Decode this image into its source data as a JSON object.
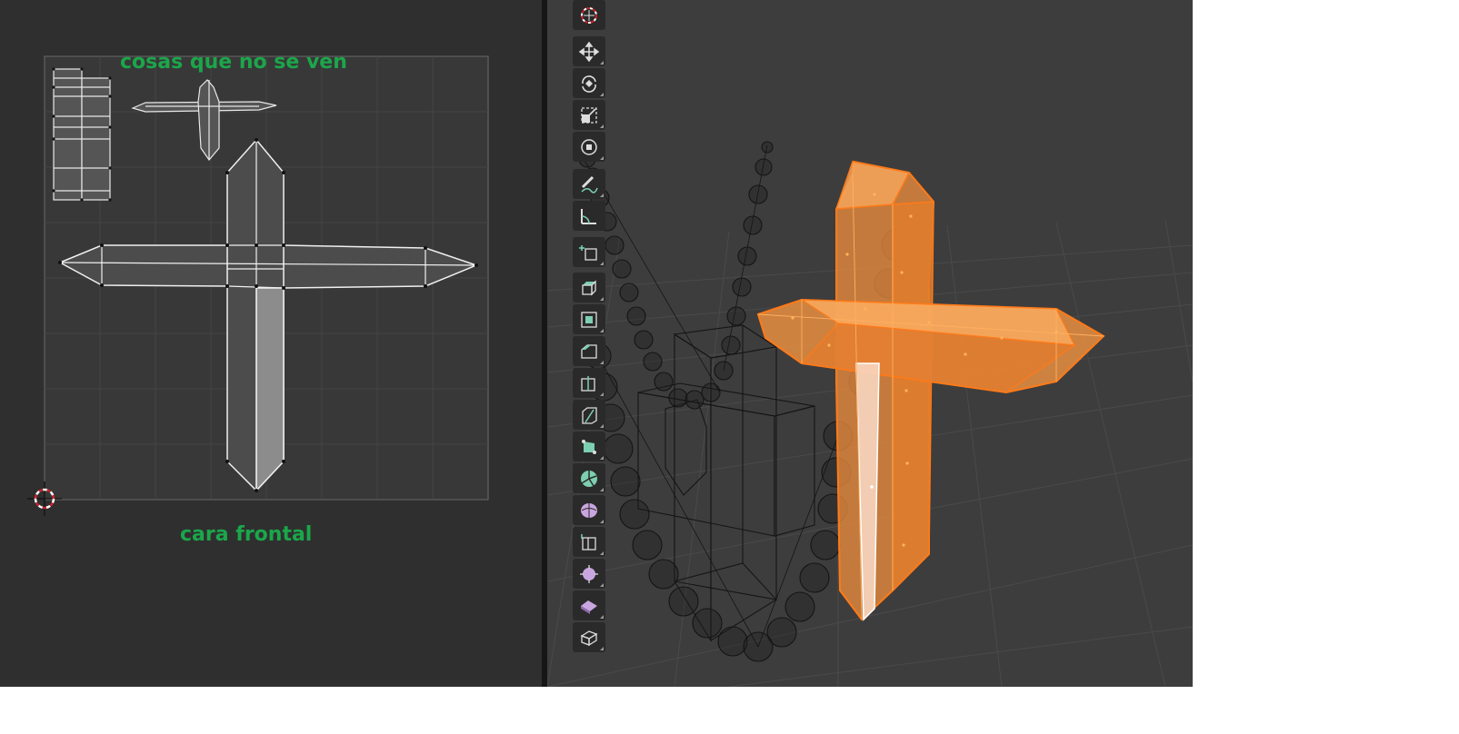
{
  "uv_editor": {
    "annotations": {
      "top_label": "cosas que no se ven",
      "bottom_label": "cara frontal"
    }
  },
  "viewport": {
    "selected_object_color": "#f08a24",
    "wire_color": "#151515"
  },
  "toolbar": {
    "tools": [
      {
        "name": "cursor-tool",
        "icon": "crosshair-circle-icon",
        "active": false
      },
      {
        "name": "move-tool",
        "icon": "move-arrows-icon",
        "active": false
      },
      {
        "name": "rotate-tool",
        "icon": "rotate-icon",
        "active": false
      },
      {
        "name": "scale-tool",
        "icon": "scale-icon",
        "active": false
      },
      {
        "name": "transform-tool",
        "icon": "transform-icon",
        "active": false
      },
      {
        "name": "annotate-tool",
        "icon": "pencil-icon",
        "active": false
      },
      {
        "name": "measure-tool",
        "icon": "ruler-icon",
        "active": false
      },
      {
        "name": "add-cube-tool",
        "icon": "add-cube-icon",
        "active": false
      },
      {
        "name": "extrude-tool",
        "icon": "extrude-icon",
        "active": false
      },
      {
        "name": "inset-faces-tool",
        "icon": "inset-icon",
        "active": false
      },
      {
        "name": "bevel-tool",
        "icon": "bevel-icon",
        "active": false
      },
      {
        "name": "loop-cut-tool",
        "icon": "loop-cut-icon",
        "active": false
      },
      {
        "name": "knife-tool",
        "icon": "knife-icon",
        "active": false
      },
      {
        "name": "poly-build-tool",
        "icon": "poly-build-icon",
        "active": false
      },
      {
        "name": "spin-tool",
        "icon": "spin-icon",
        "active": false
      },
      {
        "name": "smooth-tool",
        "icon": "smooth-icon",
        "active": false
      },
      {
        "name": "edge-slide-tool",
        "icon": "edge-slide-icon",
        "active": false
      },
      {
        "name": "shrink-fatten-tool",
        "icon": "shrink-fatten-icon",
        "active": false
      },
      {
        "name": "shear-tool",
        "icon": "shear-icon",
        "active": false
      },
      {
        "name": "rip-region-tool",
        "icon": "rip-region-icon",
        "active": false
      }
    ]
  }
}
